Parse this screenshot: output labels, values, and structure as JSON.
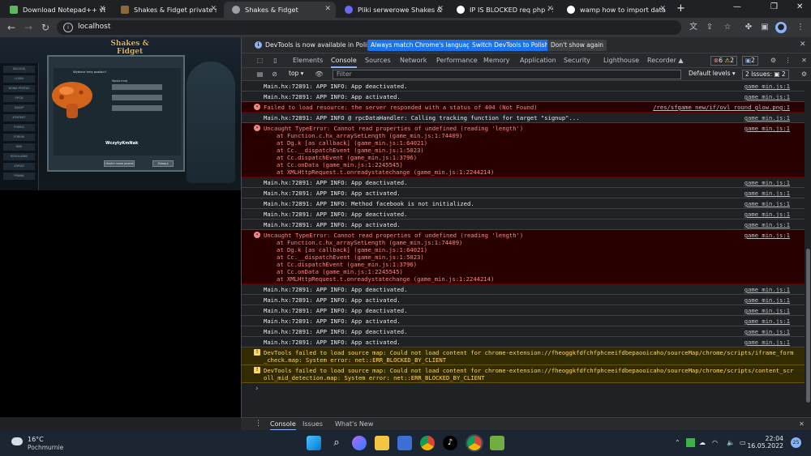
{
  "browser": {
    "tabs": [
      {
        "title": "Download Notepad++ v8.4",
        "color": "#5cb85c"
      },
      {
        "title": "Shakes & Fidget private ser",
        "color": "#8b6b3a"
      },
      {
        "title": "Shakes & Fidget",
        "color": "#9aa0a6",
        "active": true
      },
      {
        "title": "Pliki serwerowe Shakes & F",
        "color": "#6b6bf2"
      },
      {
        "title": "IP IS BLOCKED req php - Sta",
        "color": "#e8eaed"
      },
      {
        "title": "wamp how to import datab",
        "color": "#e8eaed"
      }
    ],
    "url": "localhost"
  },
  "game": {
    "logo": "Shakes & Fidget",
    "panel_title": "Wybierz imię postaci!",
    "name_input_label": "Wpisz imię",
    "typed_name": "WczytyKmNak",
    "menu_items": [
      "ZALOGUJ",
      "LOGIN",
      "NOWA POSTAĆ",
      "OPCJE",
      "ZAKUP",
      "KONTAKT",
      "POMOC",
      "FORUM",
      "WIKI",
      "REGULAMIN",
      "ZAPISZ",
      "PRAWA",
      "HISTORIA",
      "MODY",
      "CREDITS"
    ],
    "btn_back": "Utwórz nowa postać",
    "btn_ok": "Zaloguj"
  },
  "devtools": {
    "infobar": {
      "message": "DevTools is now available in Polish!",
      "btn_match": "Always match Chrome's language",
      "btn_switch": "Switch DevTools to Polish",
      "btn_dismiss": "Don't show again"
    },
    "tabs": [
      "Elements",
      "Console",
      "Sources",
      "Network",
      "Performance",
      "Memory",
      "Application",
      "Security",
      "Lighthouse",
      "Recorder ▲"
    ],
    "error_count": "6",
    "warning_count": "2",
    "info_count": "2",
    "context": "top ▾",
    "filter_placeholder": "Filter",
    "levels": "Default levels ▾",
    "issues": "2 Issues: ▣ 2",
    "rows": [
      {
        "type": "log",
        "text": "Main.hx:72891: APP INFO: App deactivated.",
        "src": "game_min.js:1"
      },
      {
        "type": "log",
        "text": "Main.hx:72891: APP INFO: App activated.",
        "src": "game_min.js:1"
      },
      {
        "type": "err",
        "text": "Failed to load resource: the server responded with a status of 404 (Not Found)",
        "src": "/res/sfgame_new/if/ovl_round_glow.png:1"
      },
      {
        "type": "log",
        "text": "Main.hx:72891: APP INFO @ rpcDataHandler: Calling tracking function for target \"signup\"...",
        "src": "game_min.js:1"
      },
      {
        "type": "err",
        "text": "Uncaught TypeError: Cannot read properties of undefined (reading 'length')",
        "src": "game_min.js:1",
        "stack": [
          "at Function.c.hx_arraySetLength (game_min.js:1:74409)",
          "at Dg.k [as callback] (game_min.js:1:64021)",
          "at Cc.__dispatchEvent (game_min.js:1:5023)",
          "at Cc.dispatchEvent (game_min.js:1:3796)",
          "at Cc.onData (game_min.js:1:2245545)",
          "at XMLHttpRequest.t.onreadystatechange (game_min.js:1:2244214)"
        ]
      },
      {
        "type": "log",
        "text": "Main.hx:72891: APP INFO: App deactivated.",
        "src": "game_min.js:1"
      },
      {
        "type": "log",
        "text": "Main.hx:72891: APP INFO: App activated.",
        "src": "game_min.js:1"
      },
      {
        "type": "log",
        "text": "Main.hx:72891: APP INFO: Method facebook is not initialized.",
        "src": "game_min.js:1"
      },
      {
        "type": "log",
        "text": "Main.hx:72891: APP INFO: App deactivated.",
        "src": "game_min.js:1"
      },
      {
        "type": "log",
        "text": "Main.hx:72891: APP INFO: App activated.",
        "src": "game_min.js:1"
      },
      {
        "type": "err",
        "text": "Uncaught TypeError: Cannot read properties of undefined (reading 'length')",
        "src": "game_min.js:1",
        "stack": [
          "at Function.c.hx_arraySetLength (game_min.js:1:74409)",
          "at Dg.k [as callback] (game_min.js:1:64021)",
          "at Cc.__dispatchEvent (game_min.js:1:5023)",
          "at Cc.dispatchEvent (game_min.js:1:3796)",
          "at Cc.onData (game_min.js:1:2245545)",
          "at XMLHttpRequest.t.onreadystatechange (game_min.js:1:2244214)"
        ]
      },
      {
        "type": "log",
        "text": "Main.hx:72891: APP INFO: App deactivated.",
        "src": "game_min.js:1"
      },
      {
        "type": "log",
        "text": "Main.hx:72891: APP INFO: App activated.",
        "src": "game_min.js:1"
      },
      {
        "type": "log",
        "text": "Main.hx:72891: APP INFO: App deactivated.",
        "src": "game_min.js:1"
      },
      {
        "type": "log",
        "text": "Main.hx:72891: APP INFO: App activated.",
        "src": "game_min.js:1"
      },
      {
        "type": "log",
        "text": "Main.hx:72891: APP INFO: App deactivated.",
        "src": "game_min.js:1"
      },
      {
        "type": "log",
        "text": "Main.hx:72891: APP INFO: App activated.",
        "src": "game_min.js:1"
      },
      {
        "type": "warn",
        "text": "DevTools failed to load source map: Could not load content for chrome-extension://fheoggkfdfchfphceeifdbepaooicaho/sourceMap/chrome/scripts/iframe_form\n_check.map: System error: net::ERR_BLOCKED_BY_CLIENT",
        "src": ""
      },
      {
        "type": "warn",
        "text": "DevTools failed to load source map: Could not load content for chrome-extension://fheoggkfdfchfphceeifdbepaooicaho/sourceMap/chrome/scripts/content_scr\noll_mid_detection.map: System error: net::ERR_BLOCKED_BY_CLIENT",
        "src": ""
      }
    ],
    "prompt": "›",
    "drawer_tabs": [
      "Console",
      "Issues",
      "What's New"
    ]
  },
  "taskbar": {
    "temperature": "16°C",
    "weather": "Pochmurnie",
    "time": "22:04",
    "date": "16.05.2022",
    "notif_count": "25"
  }
}
